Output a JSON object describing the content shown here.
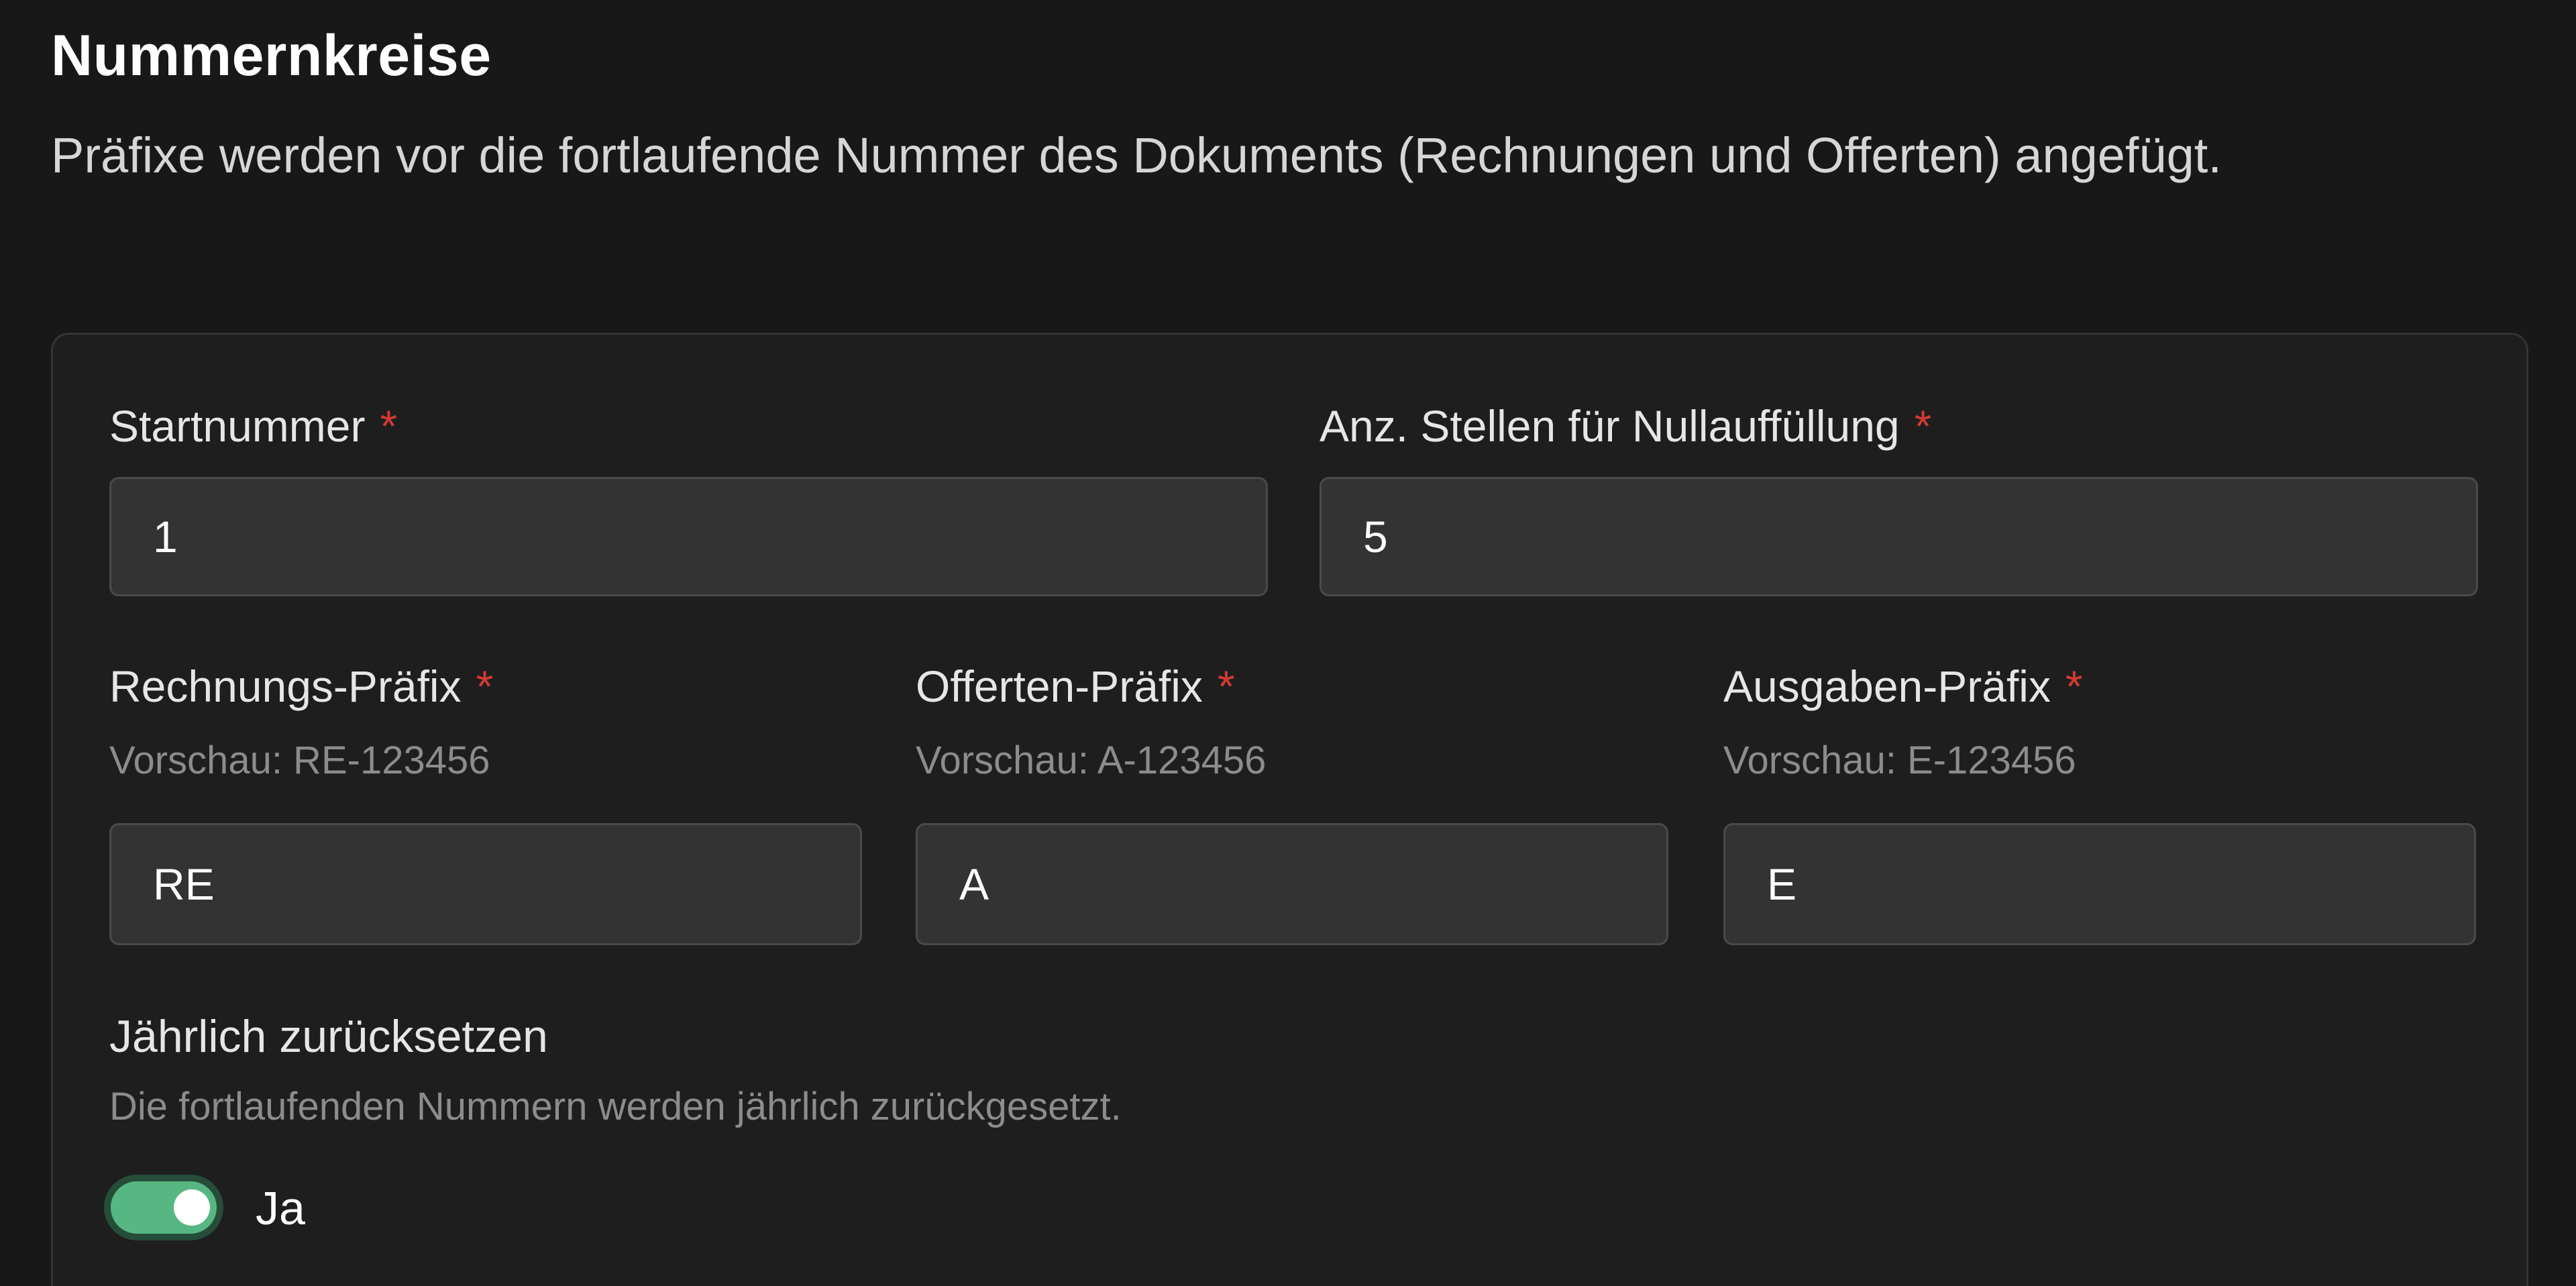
{
  "section": {
    "title": "Nummernkreise",
    "description": "Präfixe werden vor die fortlaufende Nummer des Dokuments (Rechnungen und Offerten) angefügt."
  },
  "fields": {
    "required_marker": "*",
    "start_number": {
      "label": "Startnummer",
      "value": "1"
    },
    "padding_digits": {
      "label": "Anz. Stellen für Nullauffüllung",
      "value": "5"
    },
    "invoice_prefix": {
      "label": "Rechnungs-Präfix",
      "preview": "Vorschau: RE-123456",
      "value": "RE"
    },
    "offer_prefix": {
      "label": "Offerten-Präfix",
      "preview": "Vorschau: A-123456",
      "value": "A"
    },
    "expense_prefix": {
      "label": "Ausgaben-Präfix",
      "preview": "Vorschau: E-123456",
      "value": "E"
    }
  },
  "yearly_reset": {
    "label": "Jährlich zurücksetzen",
    "description": "Die fortlaufenden Nummern werden jährlich zurückgesetzt.",
    "enabled": true,
    "state_label": "Ja"
  },
  "colors": {
    "toggle_on": "#56b782",
    "required": "#d33a32"
  }
}
